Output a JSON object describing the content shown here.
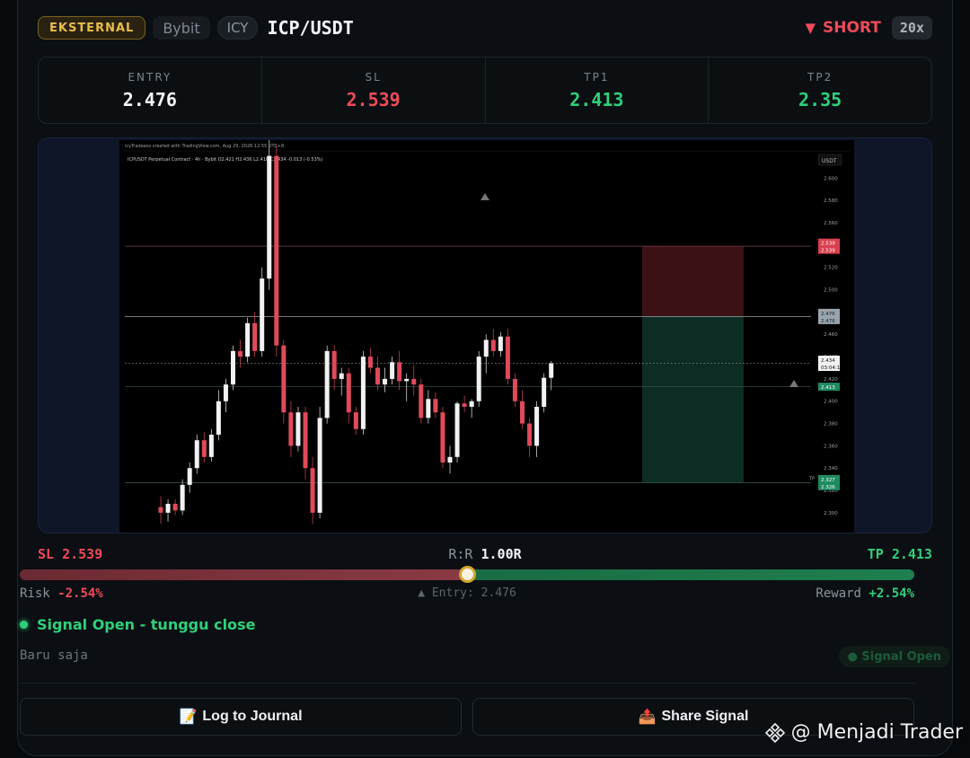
{
  "header": {
    "badge_external": "EKSTERNAL",
    "source": "Bybit",
    "tag": "ICY",
    "pair": "ICP/USDT",
    "direction": "SHORT",
    "direction_icon": "triangle-down-icon",
    "leverage": "20x"
  },
  "levels": [
    {
      "label": "ENTRY",
      "value": "2.476",
      "color": "#f3f5f8"
    },
    {
      "label": "SL",
      "value": "2.539",
      "color": "#ef4a5a"
    },
    {
      "label": "TP1",
      "value": "2.413",
      "color": "#2fd07a"
    },
    {
      "label": "TP2",
      "value": "2.35",
      "color": "#2fd07a"
    }
  ],
  "chart": {
    "title_line": "icyTradeess created with TradingView.com, Aug 29, 2026 12:55 UTC+8",
    "symbol_line": "ICPUSDT Perpetual Contract · 4h · Bybit  O2.421 H2.436 L2.410 C2.434 -0.013 (-0.53%)",
    "currency": "USDT",
    "price_ticks": [
      "2.600",
      "2.580",
      "2.560",
      "2.540",
      "2.520",
      "2.500",
      "2.480",
      "2.460",
      "2.440",
      "2.420",
      "2.400",
      "2.380",
      "2.360",
      "2.340",
      "2.320",
      "2.300",
      "2.280"
    ],
    "tags": {
      "sl": [
        "2.539",
        "2.539"
      ],
      "entry": [
        "2.476",
        "2.476"
      ],
      "last": [
        "2.434",
        "03:04:11"
      ],
      "tp1": "2.413",
      "tp2": [
        "2.327",
        "2.326"
      ],
      "tp_label": "TP"
    },
    "candles": [
      [
        2.305,
        2.315,
        2.29,
        2.3
      ],
      [
        2.3,
        2.312,
        2.292,
        2.308
      ],
      [
        2.308,
        2.312,
        2.298,
        2.302
      ],
      [
        2.302,
        2.33,
        2.298,
        2.325
      ],
      [
        2.325,
        2.345,
        2.318,
        2.34
      ],
      [
        2.34,
        2.37,
        2.335,
        2.365
      ],
      [
        2.365,
        2.372,
        2.345,
        2.35
      ],
      [
        2.35,
        2.375,
        2.346,
        2.37
      ],
      [
        2.37,
        2.41,
        2.365,
        2.4
      ],
      [
        2.4,
        2.42,
        2.39,
        2.415
      ],
      [
        2.415,
        2.45,
        2.41,
        2.445
      ],
      [
        2.445,
        2.455,
        2.43,
        2.44
      ],
      [
        2.44,
        2.475,
        2.435,
        2.47
      ],
      [
        2.47,
        2.48,
        2.44,
        2.445
      ],
      [
        2.445,
        2.52,
        2.44,
        2.51
      ],
      [
        2.51,
        2.64,
        2.5,
        2.62
      ],
      [
        2.62,
        2.63,
        2.44,
        2.45
      ],
      [
        2.45,
        2.455,
        2.38,
        2.39
      ],
      [
        2.39,
        2.4,
        2.35,
        2.36
      ],
      [
        2.36,
        2.395,
        2.355,
        2.39
      ],
      [
        2.39,
        2.395,
        2.33,
        2.34
      ],
      [
        2.34,
        2.35,
        2.29,
        2.3
      ],
      [
        2.3,
        2.395,
        2.295,
        2.385
      ],
      [
        2.385,
        2.45,
        2.38,
        2.445
      ],
      [
        2.445,
        2.45,
        2.41,
        2.42
      ],
      [
        2.42,
        2.43,
        2.405,
        2.425
      ],
      [
        2.425,
        2.43,
        2.38,
        2.39
      ],
      [
        2.39,
        2.395,
        2.37,
        2.375
      ],
      [
        2.375,
        2.445,
        2.37,
        2.44
      ],
      [
        2.44,
        2.448,
        2.425,
        2.43
      ],
      [
        2.43,
        2.44,
        2.41,
        2.415
      ],
      [
        2.415,
        2.43,
        2.408,
        2.42
      ],
      [
        2.42,
        2.44,
        2.415,
        2.435
      ],
      [
        2.435,
        2.445,
        2.41,
        2.418
      ],
      [
        2.418,
        2.425,
        2.4,
        2.42
      ],
      [
        2.42,
        2.432,
        2.405,
        2.415
      ],
      [
        2.415,
        2.42,
        2.38,
        2.385
      ],
      [
        2.385,
        2.41,
        2.38,
        2.402
      ],
      [
        2.402,
        2.408,
        2.385,
        2.39
      ],
      [
        2.39,
        2.395,
        2.34,
        2.345
      ],
      [
        2.345,
        2.36,
        2.335,
        2.35
      ],
      [
        2.35,
        2.4,
        2.345,
        2.398
      ],
      [
        2.398,
        2.405,
        2.39,
        2.395
      ],
      [
        2.395,
        2.402,
        2.385,
        2.4
      ],
      [
        2.4,
        2.445,
        2.395,
        2.44
      ],
      [
        2.44,
        2.46,
        2.425,
        2.455
      ],
      [
        2.455,
        2.465,
        2.44,
        2.445
      ],
      [
        2.445,
        2.462,
        2.44,
        2.458
      ],
      [
        2.458,
        2.465,
        2.415,
        2.42
      ],
      [
        2.42,
        2.425,
        2.395,
        2.4
      ],
      [
        2.4,
        2.41,
        2.375,
        2.38
      ],
      [
        2.38,
        2.385,
        2.35,
        2.36
      ],
      [
        2.36,
        2.4,
        2.35,
        2.395
      ],
      [
        2.395,
        2.425,
        2.39,
        2.421
      ],
      [
        2.421,
        2.436,
        2.41,
        2.434
      ]
    ]
  },
  "rr": {
    "sl_text": "SL 2.539",
    "label": "R:R",
    "value": "1.00R",
    "tp_text": "TP 2.413",
    "risk_label": "Risk",
    "risk_value": "-2.54%",
    "entry_text": "▲ Entry: 2.476",
    "reward_label": "Reward",
    "reward_value": "+2.54%",
    "position": 0.5
  },
  "status": {
    "text": "Signal Open - tunggu close",
    "ago": "Baru saja",
    "badge": "● Signal Open"
  },
  "buttons": {
    "log": "Log to Journal",
    "log_icon": "📝",
    "share": "Share Signal",
    "share_icon": "📤"
  },
  "watermark": {
    "text": "@ Menjadi Trader"
  }
}
